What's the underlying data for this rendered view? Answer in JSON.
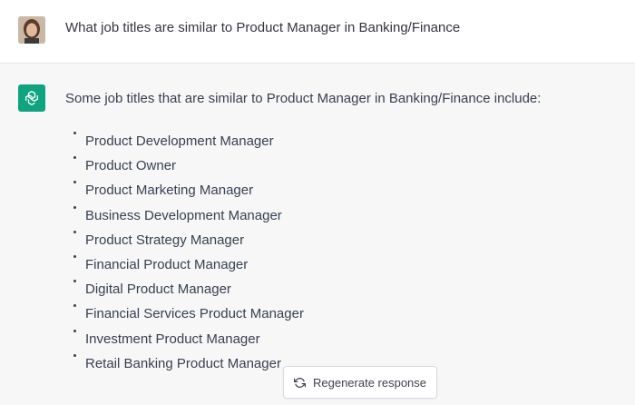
{
  "user_message": {
    "text": "What job titles are similar to Product Manager in Banking/Finance"
  },
  "assistant_message": {
    "intro": "Some job titles that are similar to Product Manager in Banking/Finance include:",
    "items": [
      "Product Development Manager",
      "Product Owner",
      "Product Marketing Manager",
      "Business Development Manager",
      "Product Strategy Manager",
      "Financial Product Manager",
      "Digital Product Manager",
      "Financial Services Product Manager",
      "Investment Product Manager",
      "Retail Banking Product Manager"
    ]
  },
  "regenerate_button": {
    "label": "Regenerate response",
    "icon": "refresh-icon"
  },
  "colors": {
    "assistant_icon_bg": "#10a37f",
    "assistant_row_bg": "#f7f7f8",
    "user_row_bg": "#ffffff"
  }
}
